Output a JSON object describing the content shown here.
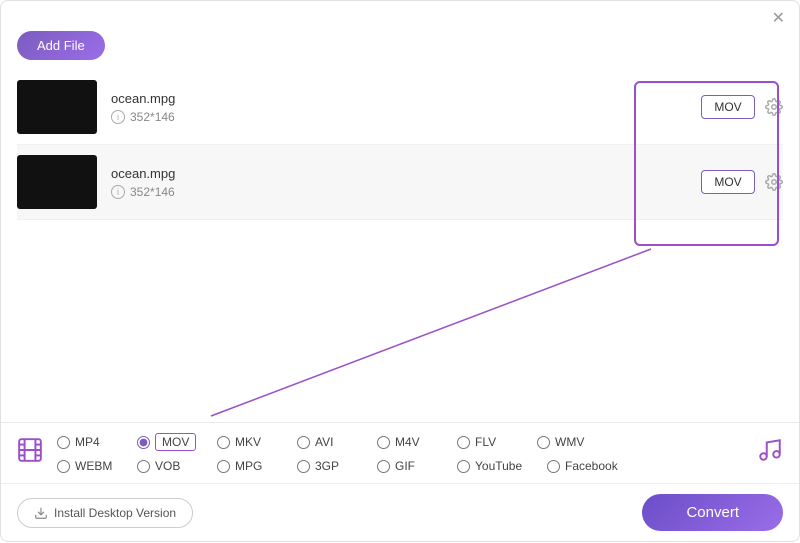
{
  "toolbar": {
    "add_file_label": "Add File"
  },
  "close": {
    "label": "✕"
  },
  "files": [
    {
      "name": "ocean.mpg",
      "dimensions": "352*146"
    },
    {
      "name": "ocean.mpg",
      "dimensions": "352*146"
    }
  ],
  "format_buttons": [
    {
      "label": "MOV"
    },
    {
      "label": "MOV"
    }
  ],
  "formats": {
    "row1": [
      {
        "id": "mp4",
        "label": "MP4",
        "selected": false
      },
      {
        "id": "mov",
        "label": "MOV",
        "selected": true
      },
      {
        "id": "mkv",
        "label": "MKV",
        "selected": false
      },
      {
        "id": "avi",
        "label": "AVI",
        "selected": false
      },
      {
        "id": "m4v",
        "label": "M4V",
        "selected": false
      },
      {
        "id": "flv",
        "label": "FLV",
        "selected": false
      },
      {
        "id": "wmv",
        "label": "WMV",
        "selected": false
      }
    ],
    "row2": [
      {
        "id": "webm",
        "label": "WEBM",
        "selected": false
      },
      {
        "id": "vob",
        "label": "VOB",
        "selected": false
      },
      {
        "id": "mpg",
        "label": "MPG",
        "selected": false
      },
      {
        "id": "3gp",
        "label": "3GP",
        "selected": false
      },
      {
        "id": "gif",
        "label": "GIF",
        "selected": false
      },
      {
        "id": "youtube",
        "label": "YouTube",
        "selected": false
      },
      {
        "id": "facebook",
        "label": "Facebook",
        "selected": false
      }
    ]
  },
  "footer": {
    "install_label": "Install Desktop Version",
    "convert_label": "Convert"
  },
  "info_icon": "i"
}
